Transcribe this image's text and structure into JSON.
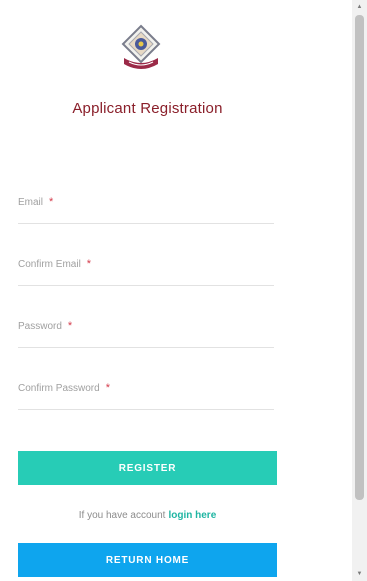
{
  "header": {
    "logo_icon": "university-crest-icon",
    "title": "Applicant Registration"
  },
  "form": {
    "required_marker": "*",
    "fields": [
      {
        "label": "Email",
        "value": "",
        "type": "email"
      },
      {
        "label": "Confirm Email",
        "value": "",
        "type": "email"
      },
      {
        "label": "Password",
        "value": "",
        "type": "password"
      },
      {
        "label": "Confirm Password",
        "value": "",
        "type": "password"
      }
    ],
    "register_label": "REGISTER"
  },
  "login": {
    "prompt": "If you have account",
    "link_label": "login here"
  },
  "return_home_label": "RETURN HOME",
  "colors": {
    "title": "#8a1f2a",
    "register_button": "#27ccb6",
    "return_home_button": "#0ea5ee",
    "required_marker": "#d43b4b",
    "login_link": "#1fb5a2"
  }
}
